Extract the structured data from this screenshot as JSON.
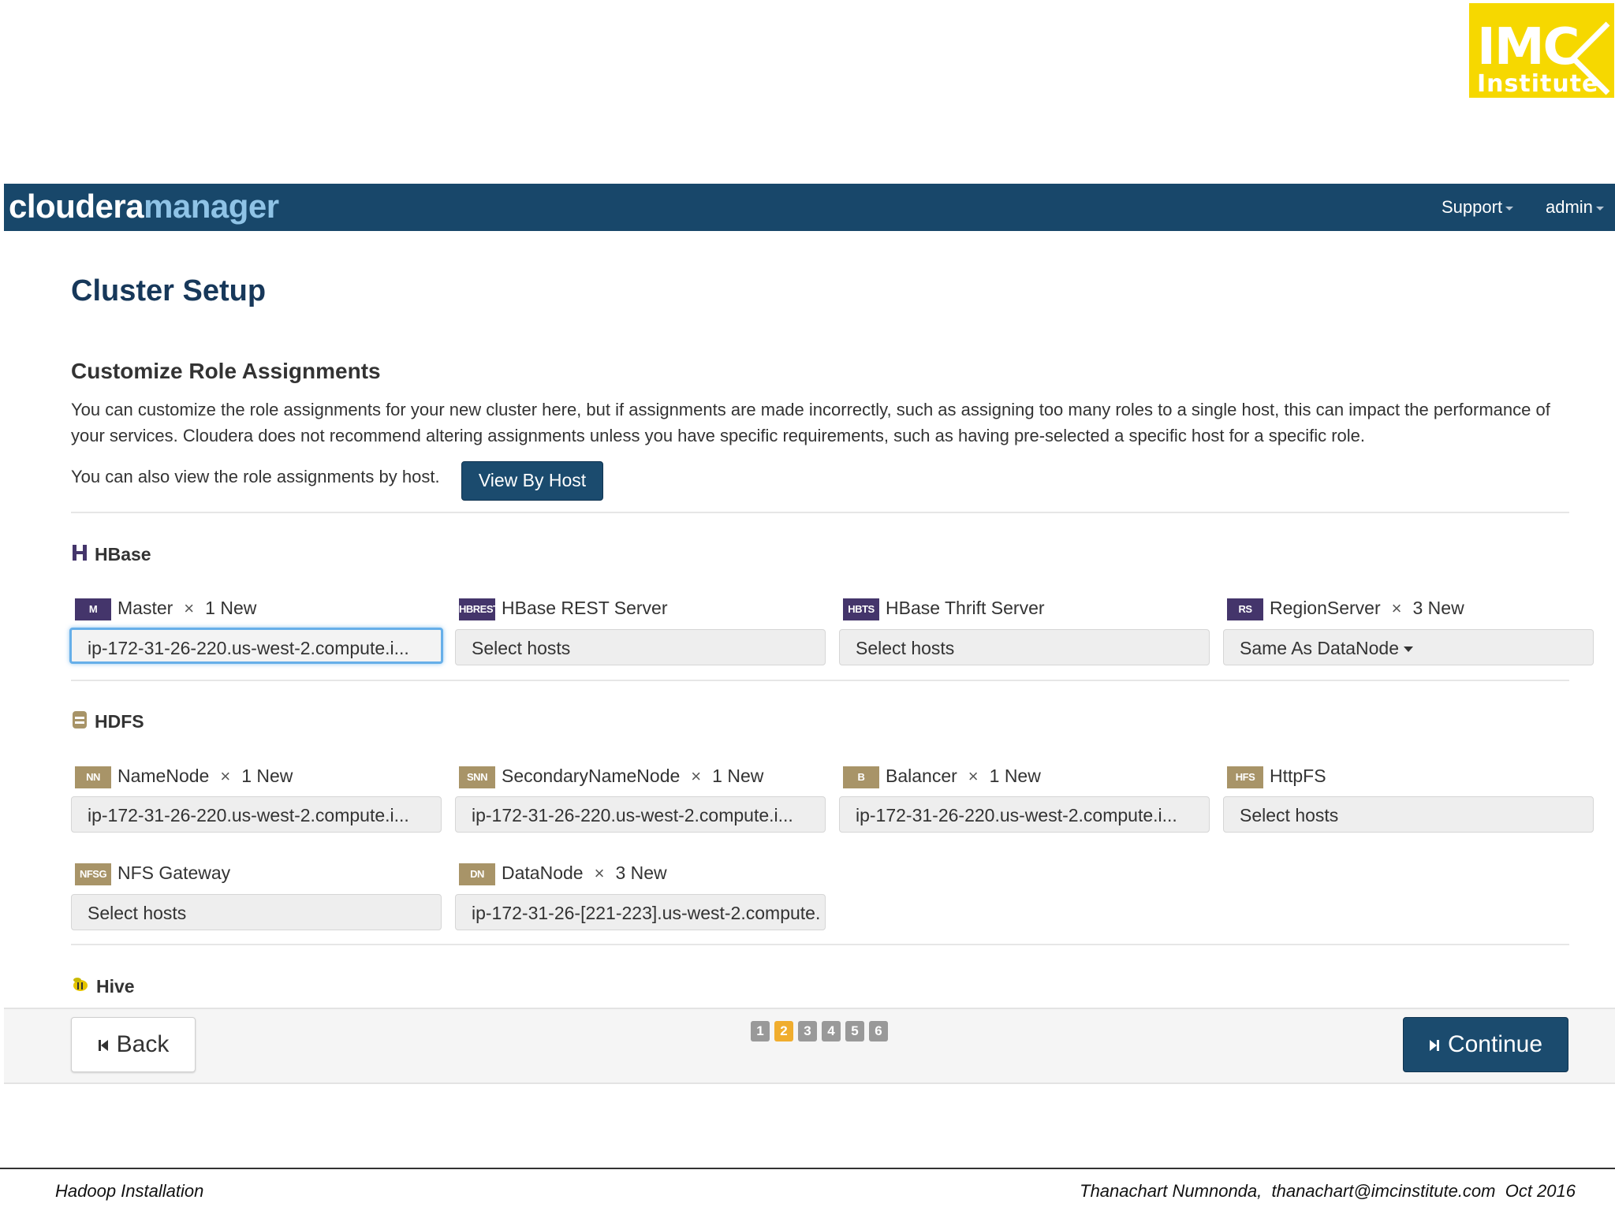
{
  "logo": {
    "line1": "IMC",
    "line2": "Institute",
    "color": "#f6d800"
  },
  "topbar": {
    "brand_part1": "cloudera",
    "brand_part2": "manager",
    "support_label": "Support",
    "admin_label": "admin",
    "background": "#18476a"
  },
  "page": {
    "title": "Cluster Setup",
    "subtitle": "Customize Role Assignments",
    "description": "You can customize the role assignments for your new cluster here, but if assignments are made incorrectly, such as assigning too many roles to a single host, this can impact the performance of your services. Cloudera does not recommend altering assignments unless you have specific requirements, such as having pre-selected a specific host for a specific role.",
    "by_host_text": "You can also view the role assignments by host.",
    "view_by_host_label": "View By Host"
  },
  "sections": {
    "hbase": {
      "title": "HBase",
      "roles": [
        {
          "badge": "M",
          "name": "Master",
          "times": "×",
          "count": "1 New",
          "value": "ip-172-31-26-220.us-west-2.compute.i..."
        },
        {
          "badge": "HBREST",
          "name": "HBase REST Server",
          "value": "Select hosts"
        },
        {
          "badge": "HBTS",
          "name": "HBase Thrift Server",
          "value": "Select hosts"
        },
        {
          "badge": "RS",
          "name": "RegionServer",
          "times": "×",
          "count": "3 New",
          "value": "Same As DataNode"
        }
      ]
    },
    "hdfs": {
      "title": "HDFS",
      "roles": [
        {
          "badge": "NN",
          "name": "NameNode",
          "times": "×",
          "count": "1 New",
          "value": "ip-172-31-26-220.us-west-2.compute.i..."
        },
        {
          "badge": "SNN",
          "name": "SecondaryNameNode",
          "times": "×",
          "count": "1 New",
          "value": "ip-172-31-26-220.us-west-2.compute.i..."
        },
        {
          "badge": "B",
          "name": "Balancer",
          "times": "×",
          "count": "1 New",
          "value": "ip-172-31-26-220.us-west-2.compute.i..."
        },
        {
          "badge": "HFS",
          "name": "HttpFS",
          "value": "Select hosts"
        },
        {
          "badge": "NFSG",
          "name": "NFS Gateway",
          "value": "Select hosts"
        },
        {
          "badge": "DN",
          "name": "DataNode",
          "times": "×",
          "count": "3 New",
          "value": "ip-172-31-26-[221-223].us-west-2.compute."
        }
      ]
    },
    "hive": {
      "title": "Hive"
    }
  },
  "wizard": {
    "back_label": "Back",
    "continue_label": "Continue",
    "pages": [
      "1",
      "2",
      "3",
      "4",
      "5",
      "6"
    ],
    "current_page": "2"
  },
  "footer": {
    "left": "Hadoop Installation",
    "right": "Thanachart Numnonda,  thanachart@imcinstitute.com  Oct 2016"
  }
}
